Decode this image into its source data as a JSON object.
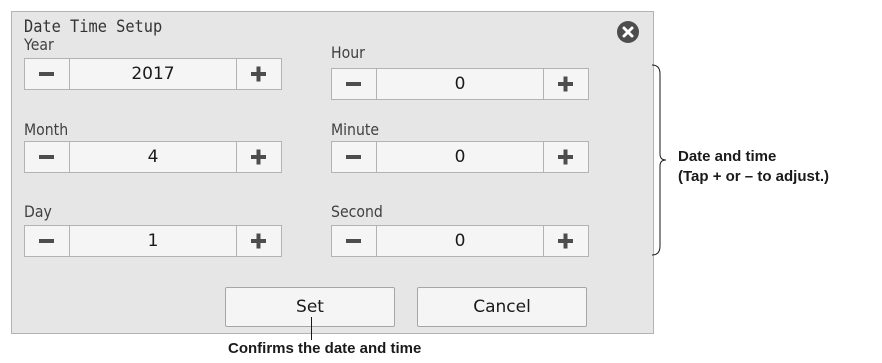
{
  "dialog": {
    "title": "Date Time Setup",
    "close_icon": "close-circle-icon"
  },
  "fields": {
    "year": {
      "label": "Year",
      "value": "2017"
    },
    "month": {
      "label": "Month",
      "value": "4"
    },
    "day": {
      "label": "Day",
      "value": "1"
    },
    "hour": {
      "label": "Hour",
      "value": "0"
    },
    "minute": {
      "label": "Minute",
      "value": "0"
    },
    "second": {
      "label": "Second",
      "value": "0"
    }
  },
  "stepper_icons": {
    "decrement": "minus-icon",
    "increment": "plus-icon"
  },
  "buttons": {
    "set": "Set",
    "cancel": "Cancel"
  },
  "annotations": {
    "side_line1": "Date and time",
    "side_line2": "(Tap + or – to adjust.)",
    "bottom": "Confirms the date and time"
  },
  "colors": {
    "dialog_bg": "#e6e6e6",
    "control_bg": "#f5f5f5",
    "border": "#b3b3b3",
    "icon": "#4d4d4d"
  }
}
